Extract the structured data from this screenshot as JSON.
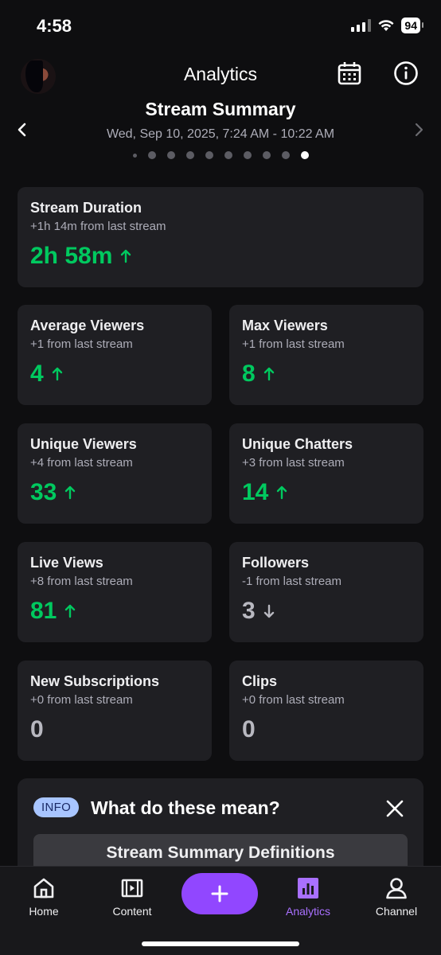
{
  "status_bar": {
    "time": "4:58",
    "battery": "94"
  },
  "header": {
    "title": "Analytics"
  },
  "summary": {
    "title": "Stream Summary",
    "date_range": "Wed, Sep 10, 2025, 7:24 AM - 10:22 AM",
    "page_count": 10,
    "active_page": 10
  },
  "stats": {
    "stream_duration": {
      "label": "Stream Duration",
      "sub": "+1h 14m from last stream",
      "value": "2h 58m",
      "trend": "up"
    },
    "average_viewers": {
      "label": "Average Viewers",
      "sub": "+1 from last stream",
      "value": "4",
      "trend": "up"
    },
    "max_viewers": {
      "label": "Max Viewers",
      "sub": "+1 from last stream",
      "value": "8",
      "trend": "up"
    },
    "unique_viewers": {
      "label": "Unique Viewers",
      "sub": "+4 from last stream",
      "value": "33",
      "trend": "up"
    },
    "unique_chatters": {
      "label": "Unique Chatters",
      "sub": "+3 from last stream",
      "value": "14",
      "trend": "up"
    },
    "live_views": {
      "label": "Live Views",
      "sub": "+8 from last stream",
      "value": "81",
      "trend": "up"
    },
    "followers": {
      "label": "Followers",
      "sub": "-1 from last stream",
      "value": "3",
      "trend": "down"
    },
    "new_subscriptions": {
      "label": "New Subscriptions",
      "sub": "+0 from last stream",
      "value": "0",
      "trend": "flat"
    },
    "clips": {
      "label": "Clips",
      "sub": "+0 from last stream",
      "value": "0",
      "trend": "flat"
    }
  },
  "info": {
    "badge": "INFO",
    "title": "What do these mean?",
    "button": "Stream Summary Definitions"
  },
  "tabs": [
    {
      "label": "Home",
      "icon": "home-icon"
    },
    {
      "label": "Content",
      "icon": "film-icon"
    },
    {
      "label": "Analytics",
      "icon": "bar-chart-icon",
      "active": true
    },
    {
      "label": "Channel",
      "icon": "user-icon"
    }
  ],
  "colors": {
    "background": "#0e0e10",
    "card": "#1f1f23",
    "positive": "#00c95f",
    "accent": "#9147ff",
    "active_tab": "#a970ff",
    "info_badge": "#a8c5ff"
  }
}
